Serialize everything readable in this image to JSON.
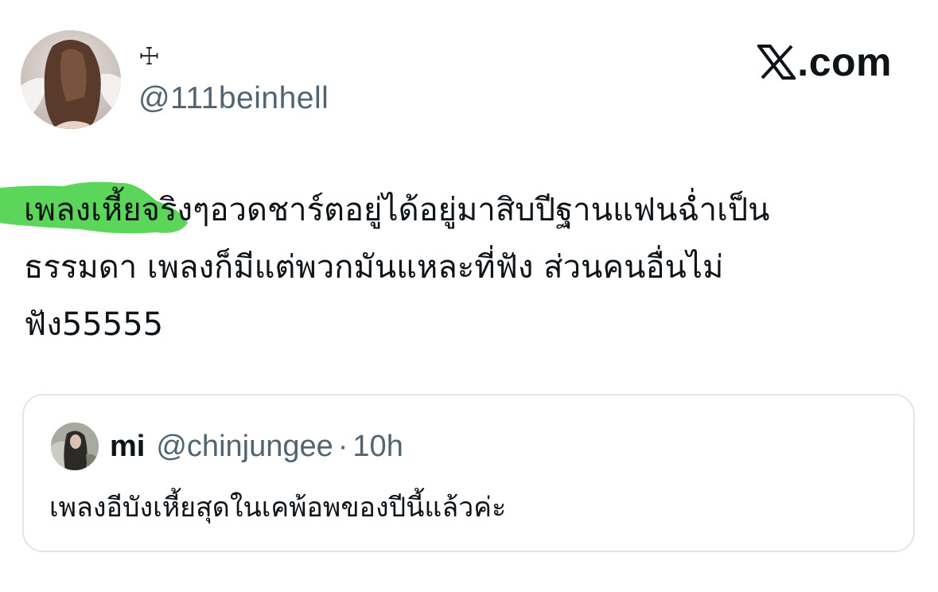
{
  "author": {
    "display_name": "☩",
    "handle": "@111beinhell",
    "avatar_icon": "profile-photo"
  },
  "brand": {
    "icon": "x-logo-icon",
    "text": ".com"
  },
  "tweet": {
    "lines": [
      "เพลงเหี้ยจริงๆอวดชาร์ตอยู่ได้อยู่มาสิบปีฐานแฟนฉ่ำเป็น",
      "ธรรมดา เพลงก็มีแต่พวกมันแหละที่ฟัง ส่วนคนอื่นไม่",
      "ฟัง55555"
    ],
    "highlight_color": "#3ecf3e"
  },
  "quote": {
    "name": "mi",
    "handle": "@chinjungee",
    "separator": "·",
    "time": "10h",
    "text": "เพลงอีบังเหี้ยสุดในเคพ้อพของปีนี้แล้วค่ะ",
    "avatar_icon": "profile-photo"
  },
  "colors": {
    "text_primary": "#0f1419",
    "text_secondary": "#536471",
    "card_border": "#e1e6ea"
  }
}
